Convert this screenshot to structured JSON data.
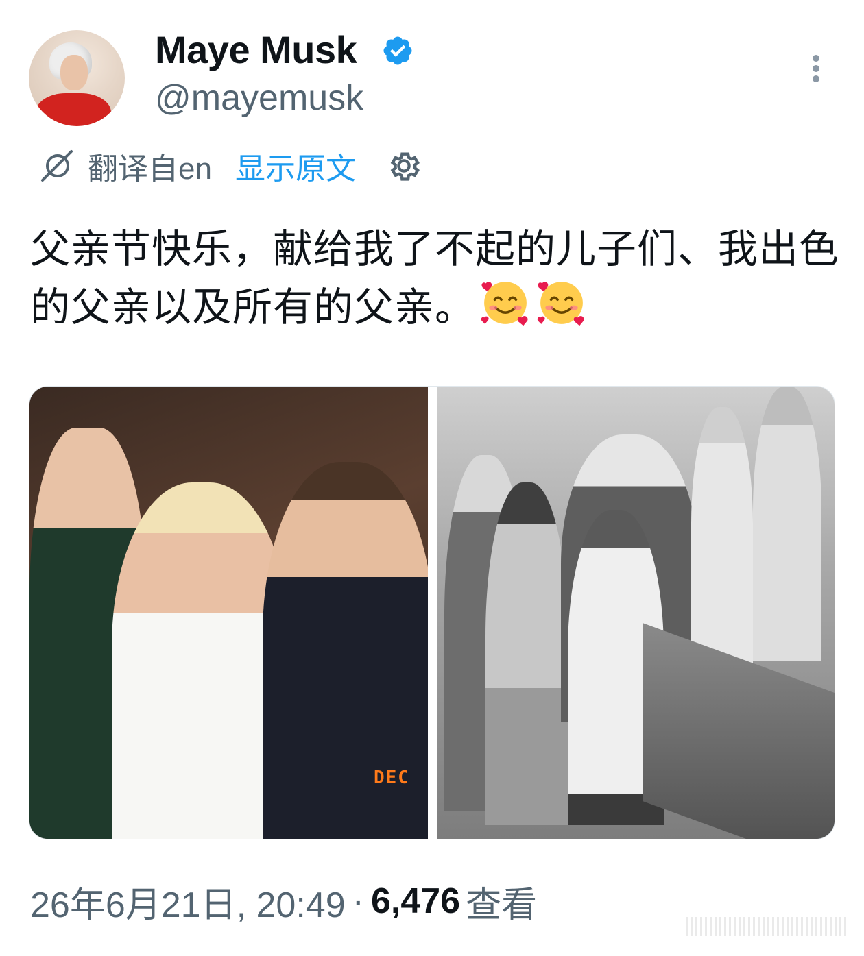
{
  "author": {
    "display_name": "Maye Musk",
    "handle": "@mayemusk",
    "verified": true
  },
  "translation": {
    "translated_from": "翻译自en",
    "show_original": "显示原文"
  },
  "tweet": {
    "text": "父亲节快乐，献给我了不起的儿子们、我出色的父亲以及所有的父亲。",
    "emojis": [
      "smiling-face-with-hearts",
      "smiling-face-with-hearts"
    ]
  },
  "media": {
    "left_photo_date_stamp": "DEC"
  },
  "meta": {
    "timestamp": "26年6月21日, 20:49",
    "separator": "·",
    "views_count": "6,476",
    "views_label": "查看"
  },
  "colors": {
    "accent": "#1d9bf0",
    "secondary_text": "#536471",
    "primary_text": "#0f1419"
  }
}
